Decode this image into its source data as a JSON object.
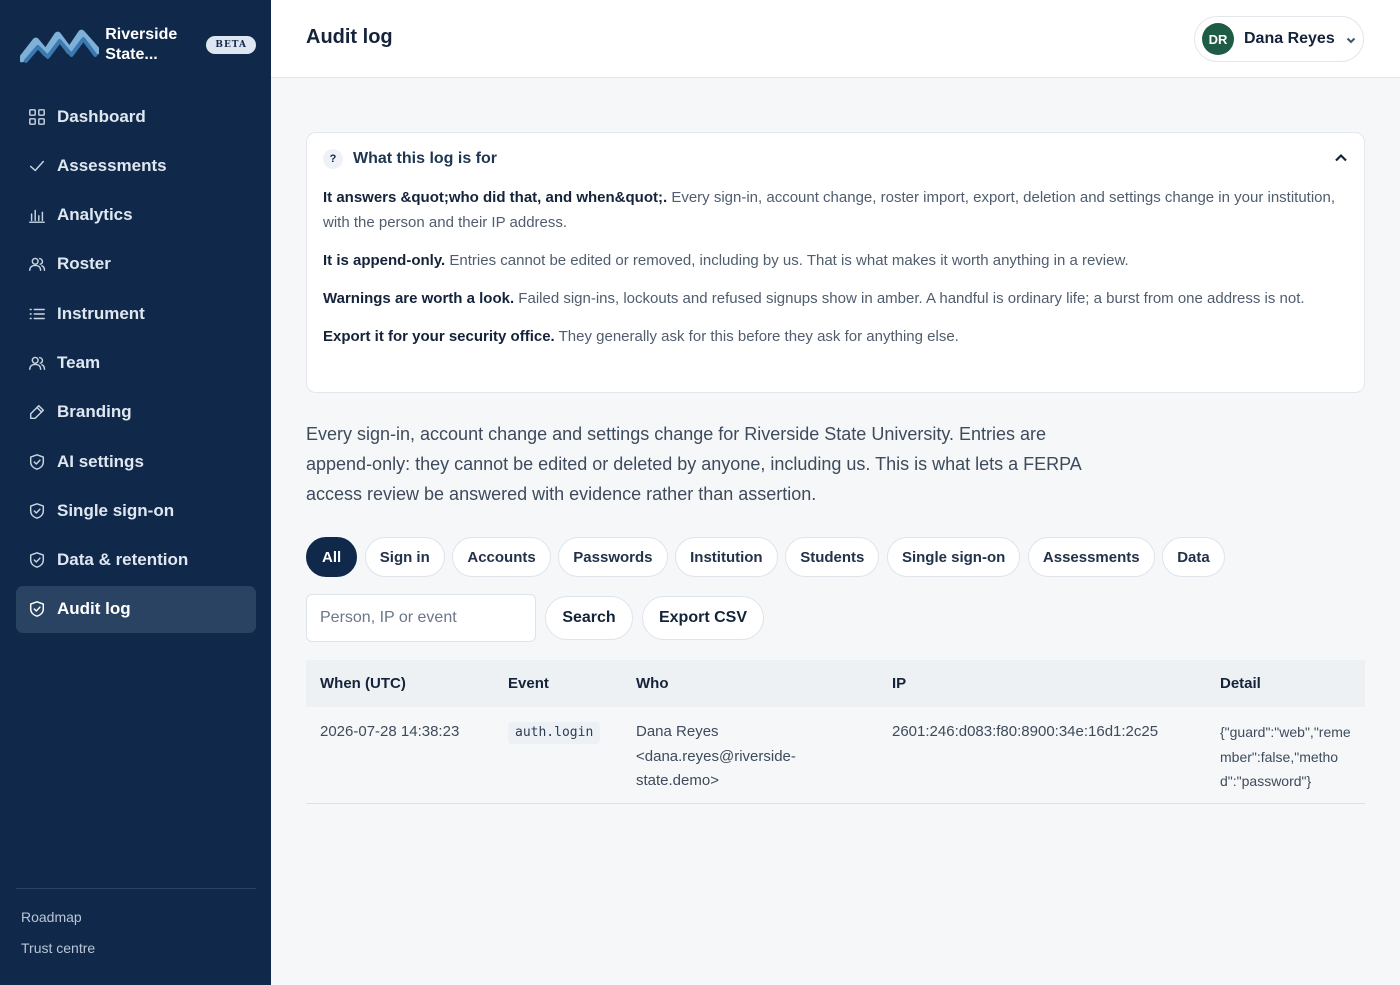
{
  "brand": {
    "name": "Riverside State...",
    "badge": "BETA"
  },
  "sidebar": {
    "items": [
      {
        "label": "Dashboard",
        "icon": "grid-icon"
      },
      {
        "label": "Assessments",
        "icon": "check-icon"
      },
      {
        "label": "Analytics",
        "icon": "bar-chart-icon"
      },
      {
        "label": "Roster",
        "icon": "users-icon"
      },
      {
        "label": "Instrument",
        "icon": "list-icon"
      },
      {
        "label": "Team",
        "icon": "users-icon"
      },
      {
        "label": "Branding",
        "icon": "brush-icon"
      },
      {
        "label": "AI settings",
        "icon": "shield-icon"
      },
      {
        "label": "Single sign-on",
        "icon": "shield-icon"
      },
      {
        "label": "Data & retention",
        "icon": "shield-icon"
      },
      {
        "label": "Audit log",
        "icon": "shield-icon",
        "active": true
      }
    ],
    "footer": {
      "roadmap": "Roadmap",
      "trust": "Trust centre"
    }
  },
  "header": {
    "title": "Audit log",
    "user": {
      "initials": "DR",
      "name": "Dana Reyes"
    }
  },
  "info": {
    "badge": "?",
    "title": "What this log is for",
    "paragraphs": [
      {
        "lead": "It answers &quot;who did that, and when&quot;.",
        "text": " Every sign-in, account change, roster import, export, deletion and settings change in your institution, with the person and their IP address."
      },
      {
        "lead": "It is append-only.",
        "text": " Entries cannot be edited or removed, including by us. That is what makes it worth anything in a review."
      },
      {
        "lead": "Warnings are worth a look.",
        "text": " Failed sign-ins, lockouts and refused signups show in amber. A handful is ordinary life; a burst from one address is not."
      },
      {
        "lead": "Export it for your security office.",
        "text": " They generally ask for this before they ask for anything else."
      }
    ]
  },
  "intro": "Every sign-in, account change and settings change for Riverside State University. Entries are append-only: they cannot be edited or deleted by anyone, including us. This is what lets a FERPA access review be answered with evidence rather than assertion.",
  "filters": [
    "All",
    "Sign in",
    "Accounts",
    "Passwords",
    "Institution",
    "Students",
    "Single sign-on",
    "Assessments",
    "Data"
  ],
  "search": {
    "placeholder": "Person, IP or event",
    "button": "Search",
    "export": "Export CSV"
  },
  "table": {
    "headers": [
      "When (UTC)",
      "Event",
      "Who",
      "IP",
      "Detail"
    ],
    "rows": [
      {
        "when": "2026-07-28 14:38:23",
        "event": "auth.login",
        "who": "Dana Reyes <dana.reyes@riverside-state.demo>",
        "ip": "2601:246:d083:f80:8900:34e:16d1:2c25",
        "detail": "{\"guard\":\"web\",\"remember\":false,\"method\":\"password\"}"
      }
    ]
  },
  "colors": {
    "sidebar": "#10294a",
    "active_nav": "#2b4363",
    "avatar": "#1f5c46"
  }
}
